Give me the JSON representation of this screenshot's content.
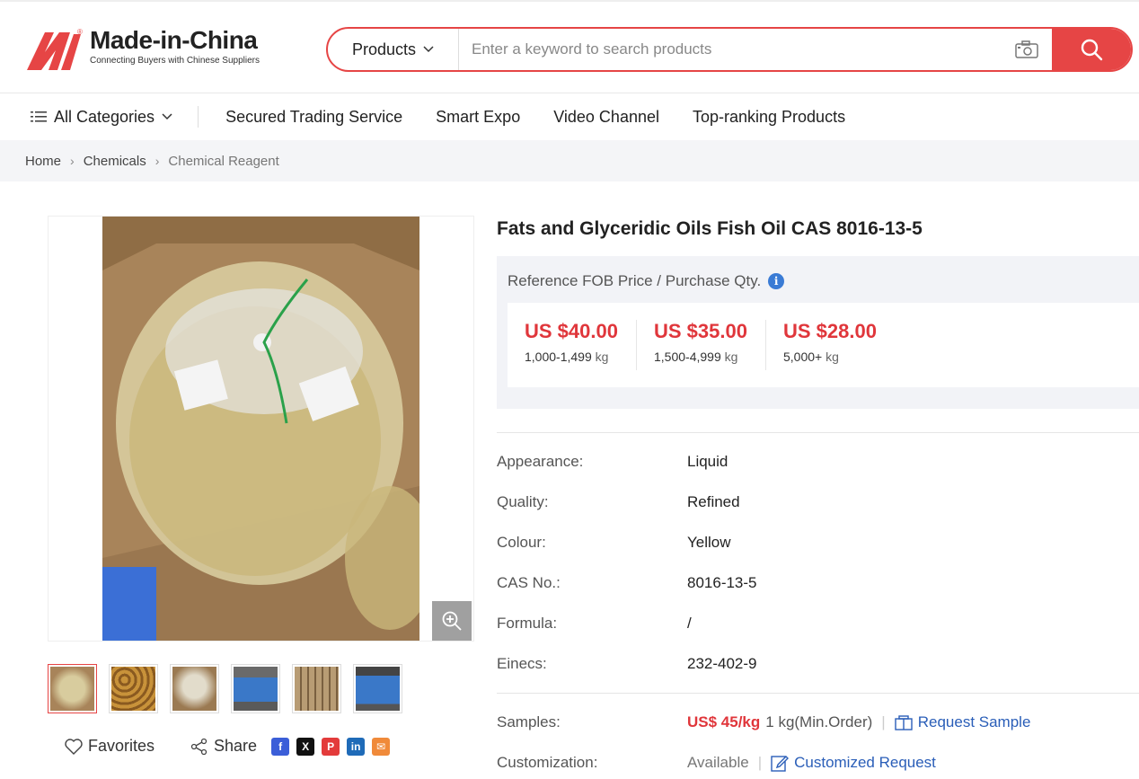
{
  "brand": {
    "name": "Made-in-China",
    "tagline": "Connecting Buyers with Chinese Suppliers",
    "color": "#e64545"
  },
  "search": {
    "type_label": "Products",
    "placeholder": "Enter a keyword to search products"
  },
  "nav": {
    "all_categories": "All Categories",
    "items": [
      "Secured Trading Service",
      "Smart Expo",
      "Video Channel",
      "Top-ranking Products"
    ]
  },
  "breadcrumb": [
    "Home",
    "Chemicals",
    "Chemical Reagent"
  ],
  "product": {
    "title": "Fats and Glyceridic Oils Fish Oil CAS 8016-13-5",
    "price_heading": "Reference FOB Price / Purchase Qty.",
    "tiers": [
      {
        "price": "US $40.00",
        "qty": "1,000-1,499",
        "unit": "kg"
      },
      {
        "price": "US $35.00",
        "qty": "1,500-4,999",
        "unit": "kg"
      },
      {
        "price": "US $28.00",
        "qty": "5,000+",
        "unit": "kg"
      }
    ],
    "attributes": [
      {
        "key": "Appearance:",
        "value": "Liquid"
      },
      {
        "key": "Quality:",
        "value": "Refined"
      },
      {
        "key": "Colour:",
        "value": "Yellow"
      },
      {
        "key": "CAS No.:",
        "value": "8016-13-5"
      },
      {
        "key": "Formula:",
        "value": "/"
      },
      {
        "key": "Einecs:",
        "value": "232-402-9"
      }
    ],
    "samples": {
      "key": "Samples:",
      "price": "US$ 45/kg",
      "min": "1 kg(Min.Order)",
      "link": "Request Sample"
    },
    "customization": {
      "key": "Customization:",
      "status": "Available",
      "link": "Customized Request"
    }
  },
  "actions": {
    "favorites": "Favorites",
    "share": "Share"
  },
  "price_color": "#e0363b"
}
